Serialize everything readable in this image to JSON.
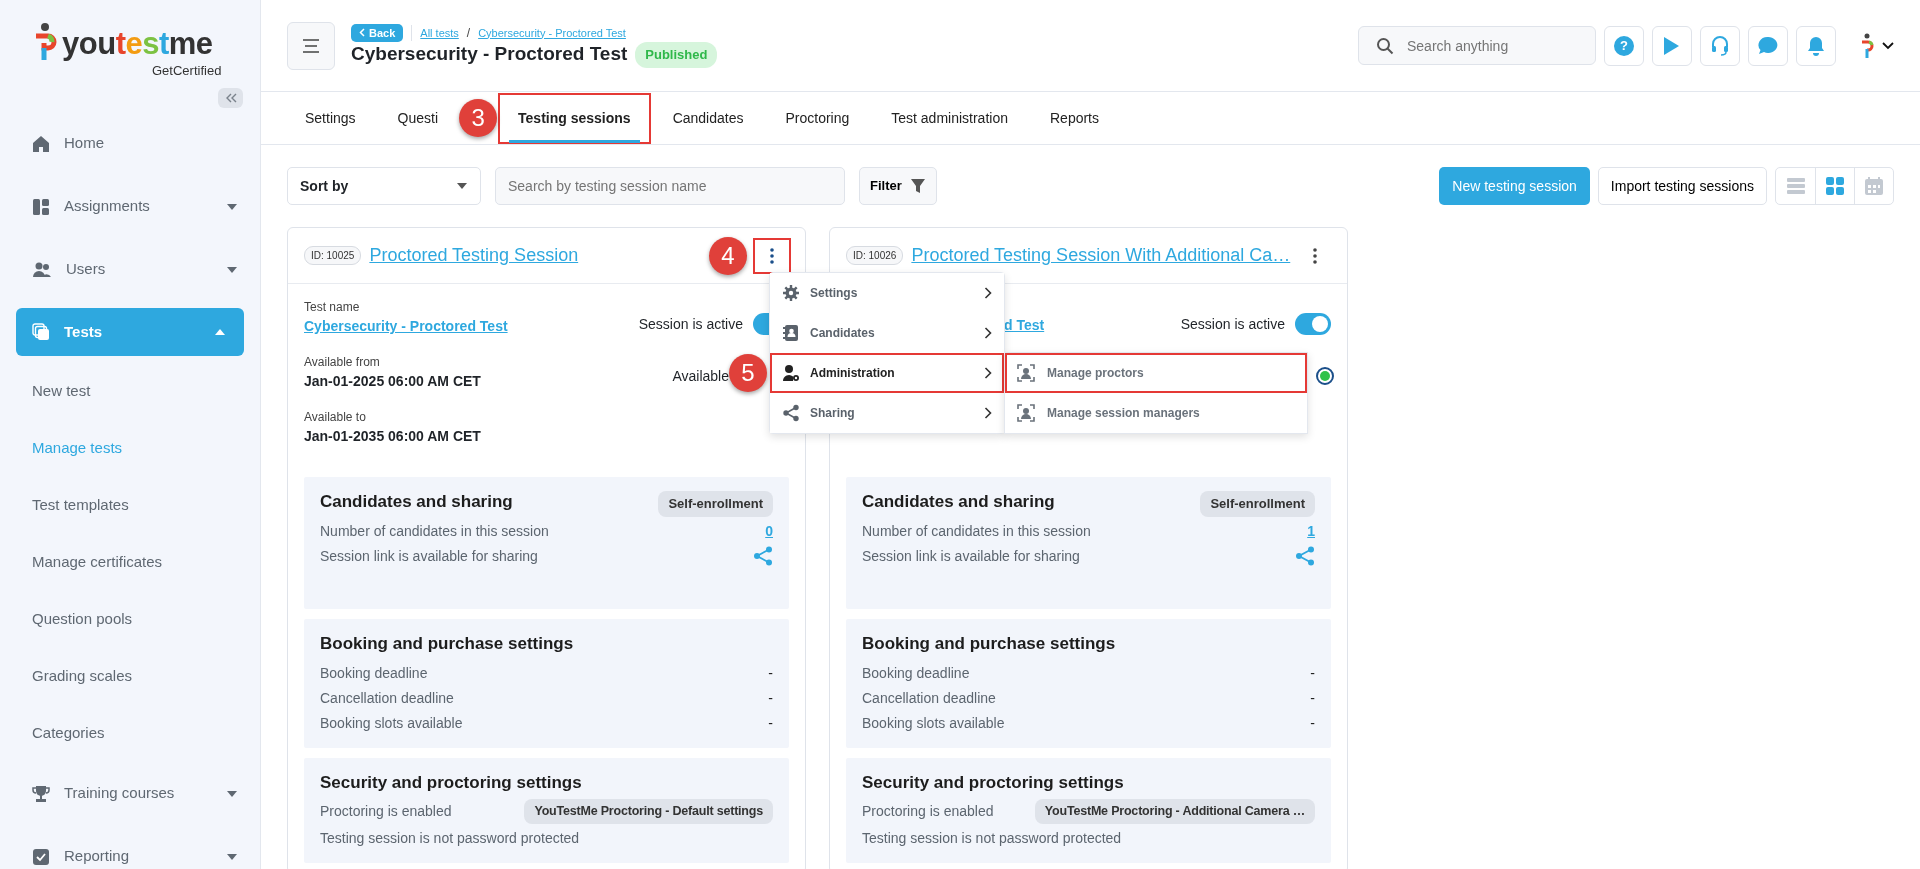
{
  "sidebar": {
    "logo": {
      "parts": [
        {
          "text": "you",
          "color": "#333333"
        },
        {
          "text": "t",
          "color": "#e8452c"
        },
        {
          "text": "e",
          "color": "#f39c12"
        },
        {
          "text": "s",
          "color": "#7cc242"
        },
        {
          "text": "t",
          "color": "#2ea8df"
        },
        {
          "text": "me",
          "color": "#333333"
        }
      ],
      "tagline": "GetCertified"
    },
    "items": [
      {
        "label": "Home",
        "kind": "link",
        "selected": false
      },
      {
        "label": "Assignments",
        "kind": "group",
        "expanded": false,
        "selected": false
      },
      {
        "label": "Users",
        "kind": "group",
        "expanded": false,
        "selected": false
      },
      {
        "label": "Tests",
        "kind": "group",
        "expanded": true,
        "selected": true,
        "children": [
          {
            "label": "New test",
            "selected": false
          },
          {
            "label": "Manage tests",
            "selected": true
          },
          {
            "label": "Test templates",
            "selected": false
          },
          {
            "label": "Manage certificates",
            "selected": false
          },
          {
            "label": "Question pools",
            "selected": false
          },
          {
            "label": "Grading scales",
            "selected": false
          },
          {
            "label": "Categories",
            "selected": false
          }
        ]
      },
      {
        "label": "Training courses",
        "kind": "group",
        "expanded": false,
        "selected": false
      },
      {
        "label": "Reporting",
        "kind": "group",
        "expanded": false,
        "selected": false
      }
    ]
  },
  "header": {
    "back": "Back",
    "breadcrumbs": [
      "All tests",
      "Cybersecurity - Proctored Test"
    ],
    "separator": "/",
    "title": "Cybersecurity - Proctored Test",
    "status": "Published",
    "search_placeholder": "Search anything",
    "help_glyph": "?"
  },
  "tabs": [
    {
      "label": "Settings",
      "selected": false,
      "highlighted": false
    },
    {
      "label": "Questi",
      "selected": false,
      "highlighted": false
    },
    {
      "label": "Testing sessions",
      "selected": true,
      "highlighted": true,
      "step": "3"
    },
    {
      "label": "Candidates",
      "selected": false,
      "highlighted": false
    },
    {
      "label": "Proctoring",
      "selected": false,
      "highlighted": false
    },
    {
      "label": "Test administration",
      "selected": false,
      "highlighted": false
    },
    {
      "label": "Reports",
      "selected": false,
      "highlighted": false
    }
  ],
  "toolbar": {
    "sort": "Sort by",
    "search_placeholder": "Search by testing session name",
    "filter": "Filter",
    "new_button": "New testing session",
    "import_button": "Import testing sessions",
    "views": [
      {
        "kind": "list",
        "selected": false
      },
      {
        "kind": "grid",
        "selected": true
      },
      {
        "kind": "calendar",
        "selected": false
      }
    ]
  },
  "cards": [
    {
      "id": "ID: 10025",
      "title": "Proctored Testing Session",
      "menu_highlighted": true,
      "step": "4",
      "test_name_label": "Test name",
      "test_name": "Cybersecurity - Proctored Test",
      "active_label": "Session is active",
      "active": true,
      "from_label": "Available from",
      "from": "Jan-01-2025 06:00 AM CET",
      "to_label": "Available to",
      "to": "Jan-01-2035 06:00 AM CET",
      "available_label": "Available",
      "menu": [
        {
          "label": "Settings",
          "highlighted": false
        },
        {
          "label": "Candidates",
          "highlighted": false
        },
        {
          "label": "Administration",
          "highlighted": true,
          "step": "5",
          "expanded": true,
          "children": [
            {
              "label": "Manage proctors",
              "highlighted": true
            },
            {
              "label": "Manage session managers",
              "highlighted": false
            }
          ]
        },
        {
          "label": "Sharing",
          "highlighted": false
        }
      ],
      "sections": [
        {
          "title": "Candidates and sharing",
          "tag": "Self-enrollment",
          "rows": [
            {
              "kind": "link",
              "label": "Number of candidates in this session",
              "value": "0"
            },
            {
              "kind": "share",
              "label": "Session link is available for sharing"
            }
          ]
        },
        {
          "title": "Booking and purchase settings",
          "rows": [
            {
              "kind": "value",
              "label": "Booking deadline",
              "value": "-"
            },
            {
              "kind": "value",
              "label": "Cancellation deadline",
              "value": "-"
            },
            {
              "kind": "value",
              "label": "Booking slots available",
              "value": "-"
            }
          ]
        },
        {
          "title": "Security and proctoring settings",
          "rows": [
            {
              "kind": "tag",
              "label": "Proctoring is enabled",
              "value": "YouTestMe Proctoring - Default settings"
            },
            {
              "kind": "text",
              "label": "Testing session is not password protected"
            }
          ]
        }
      ]
    },
    {
      "id": "ID: 10026",
      "title": "Proctored Testing Session With Additional Ca…",
      "menu_highlighted": false,
      "test_name": "d Test",
      "active_label": "Session is active",
      "active": true,
      "available": true,
      "sections": [
        {
          "title": "Candidates and sharing",
          "tag": "Self-enrollment",
          "rows": [
            {
              "kind": "link",
              "label": "Number of candidates in this session",
              "value": "1"
            },
            {
              "kind": "share",
              "label": "Session link is available for sharing"
            }
          ]
        },
        {
          "title": "Booking and purchase settings",
          "rows": [
            {
              "kind": "value",
              "label": "Booking deadline",
              "value": "-"
            },
            {
              "kind": "value",
              "label": "Cancellation deadline",
              "value": "-"
            },
            {
              "kind": "value",
              "label": "Booking slots available",
              "value": "-"
            }
          ]
        },
        {
          "title": "Security and proctoring settings",
          "rows": [
            {
              "kind": "tag",
              "label": "Proctoring is enabled",
              "value": "YouTestMe Proctoring - Additional Camera …"
            },
            {
              "kind": "text",
              "label": "Testing session is not password protected"
            }
          ]
        }
      ]
    }
  ]
}
